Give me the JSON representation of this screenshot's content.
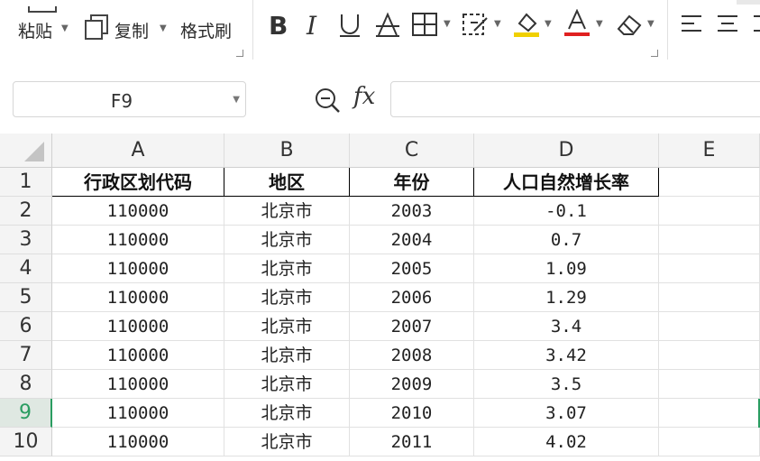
{
  "toolbar": {
    "paste_label": "粘贴",
    "copy_label": "复制",
    "format_painter_label": "格式刷",
    "underline_color": "#f0d000",
    "font_color": "#e02020"
  },
  "formula_bar": {
    "name_box": "F9",
    "fx_label": "fx",
    "formula_value": ""
  },
  "sheet": {
    "columns": [
      "A",
      "B",
      "C",
      "D",
      "E"
    ],
    "active_row": "9",
    "active_color": "#2a9d61",
    "rows": [
      {
        "num": "1",
        "cells": [
          "行政区划代码",
          "地区",
          "年份",
          "人口自然增长率"
        ]
      },
      {
        "num": "2",
        "cells": [
          "110000",
          "北京市",
          "2003",
          "-0.1"
        ]
      },
      {
        "num": "3",
        "cells": [
          "110000",
          "北京市",
          "2004",
          "0.7"
        ]
      },
      {
        "num": "4",
        "cells": [
          "110000",
          "北京市",
          "2005",
          "1.09"
        ]
      },
      {
        "num": "5",
        "cells": [
          "110000",
          "北京市",
          "2006",
          "1.29"
        ]
      },
      {
        "num": "6",
        "cells": [
          "110000",
          "北京市",
          "2007",
          "3.4"
        ]
      },
      {
        "num": "7",
        "cells": [
          "110000",
          "北京市",
          "2008",
          "3.42"
        ]
      },
      {
        "num": "8",
        "cells": [
          "110000",
          "北京市",
          "2009",
          "3.5"
        ]
      },
      {
        "num": "9",
        "cells": [
          "110000",
          "北京市",
          "2010",
          "3.07"
        ]
      },
      {
        "num": "10",
        "cells": [
          "110000",
          "北京市",
          "2011",
          "4.02"
        ]
      }
    ]
  }
}
